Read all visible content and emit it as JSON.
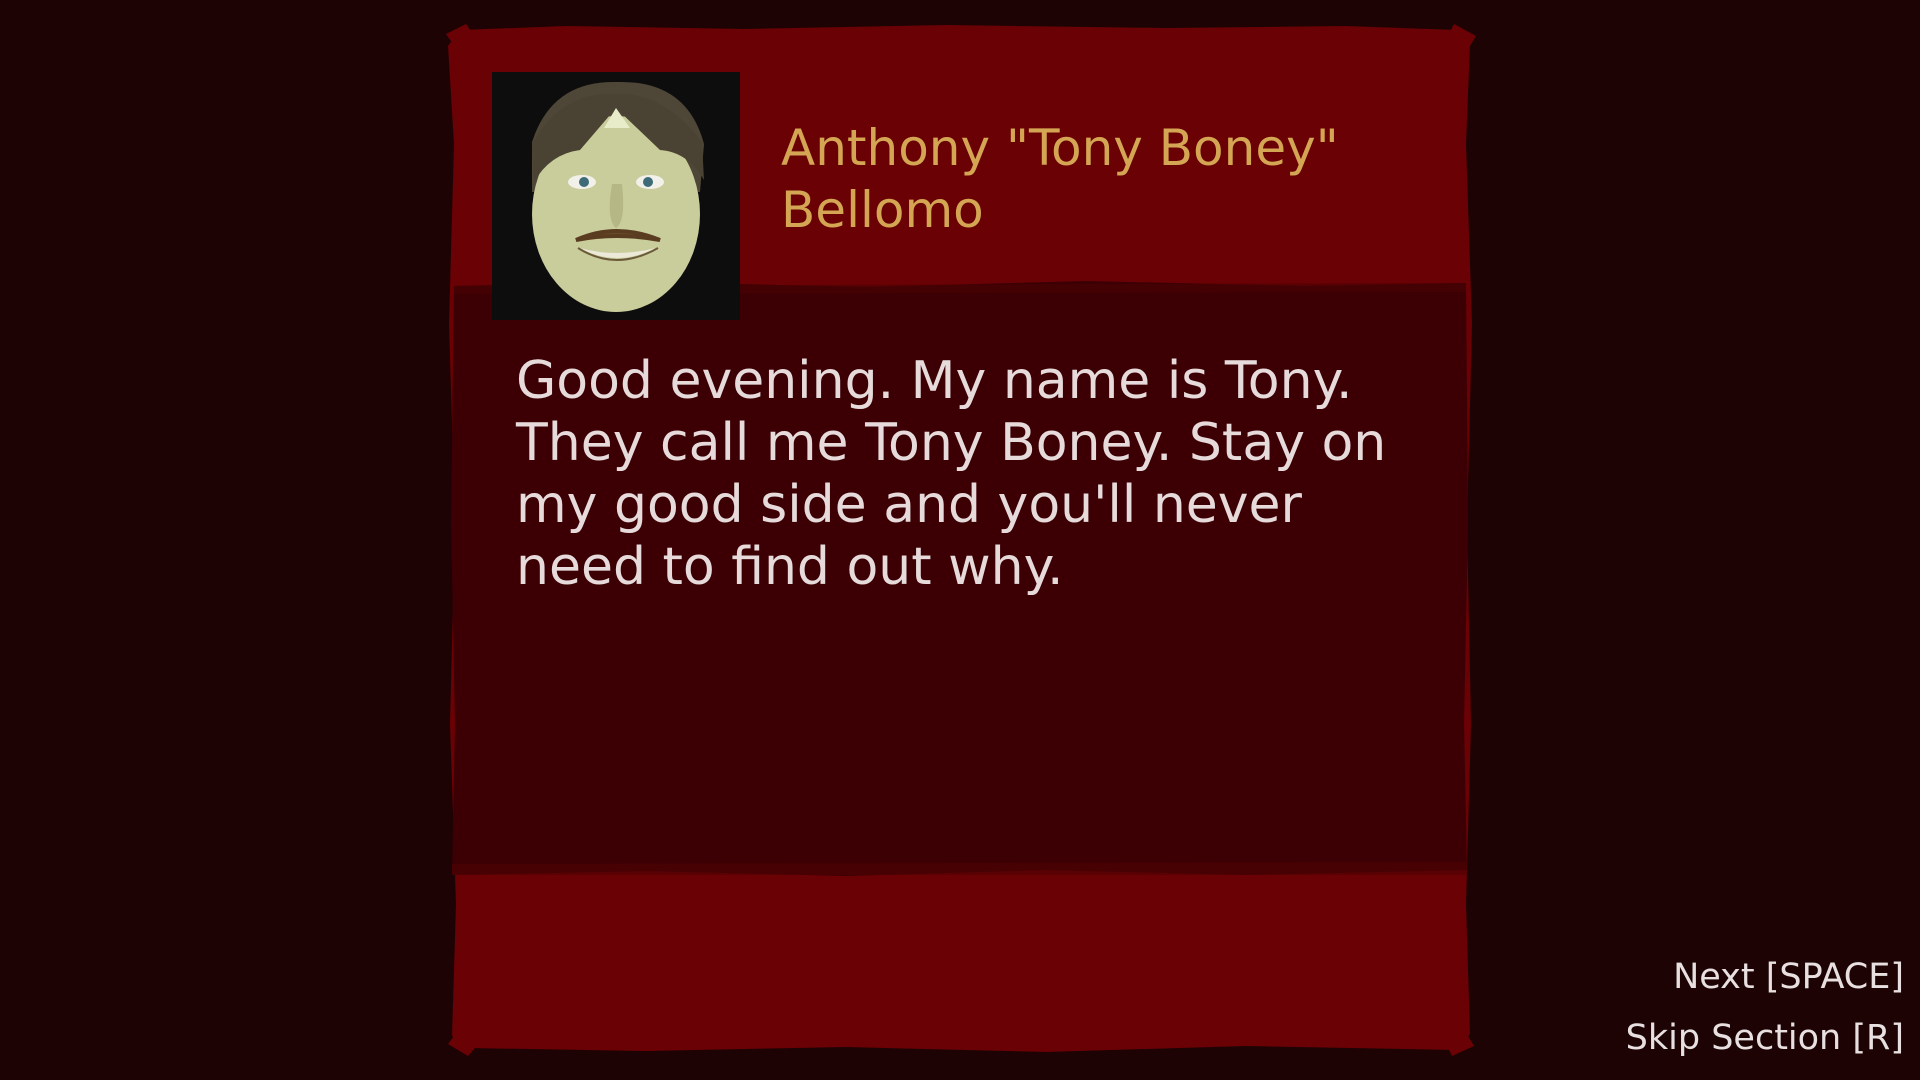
{
  "dialog": {
    "speaker_name": "Anthony \"Tony Boney\" Bellomo",
    "portrait_icon": "character-portrait",
    "text": "Good evening. My name is Tony. They call me Tony Boney. Stay on my good side and you'll never need to find out why."
  },
  "controls": {
    "next_label": "Next [SPACE]",
    "skip_label": "Skip Section [R]"
  },
  "colors": {
    "background": "#1e0305",
    "panel_band": "#6a0104",
    "panel_body": "#3c0004",
    "name_text": "#d4a553",
    "dialog_text": "#e6dada"
  }
}
